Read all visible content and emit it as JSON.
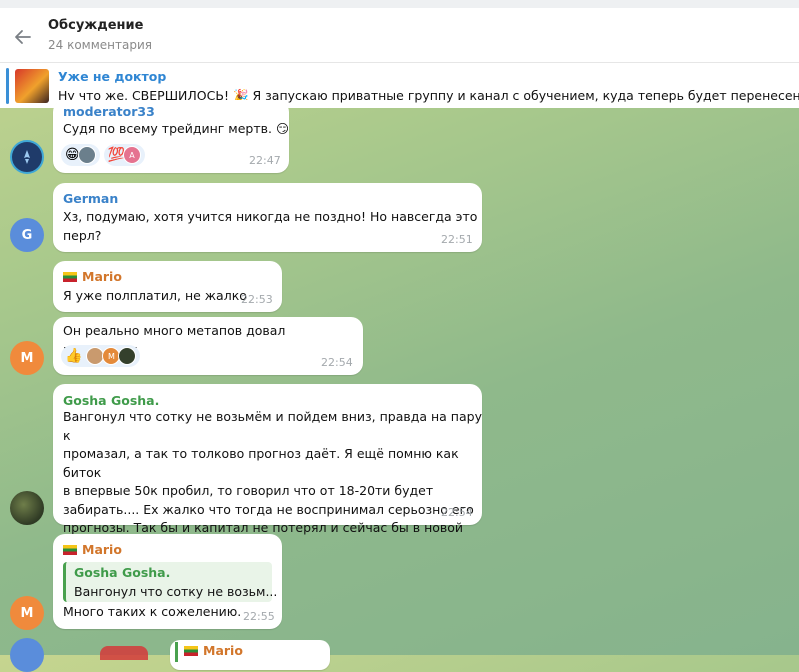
{
  "header": {
    "title": "Обсуждение",
    "subtitle": "24 комментария"
  },
  "pinned": {
    "name": "Уже не доктор",
    "text": "Ну что же, СВЕРШИЛОСЬ! 🎉  Я запускаю приватные группу и канал с обучением, куда теперь будет перенесено в"
  },
  "messages": [
    {
      "sender": "moderator33",
      "text": "Судя по всему трейдинг мертв. 😏",
      "time": "22:47",
      "reactions": [
        "😁",
        "💯"
      ]
    },
    {
      "sender": "German",
      "avatar_letter": "G",
      "text_lines": [
        "Хз, подумаю, хотя учится никогда не поздно! Но навсегда это",
        "перл?"
      ],
      "time": "22:51"
    },
    {
      "sender": "Mario",
      "text": "Я уже полплатил, не жалко",
      "time": "22:53"
    },
    {
      "text": "Он реально много метапов довал подьемных",
      "time": "22:54",
      "avatar_letter": "M",
      "reactions": [
        "👍"
      ]
    },
    {
      "sender": "Gosha Gosha.",
      "text_lines": [
        "Вангонул что сотку не возьмём и пойдем вниз, правда на пару к",
        "промазал, а так то толково прогноз даёт. Я ещё помню как биток",
        "в впервые 50к пробил, то говорил что от 18-20ти будет",
        "забирать.... Ех жалко что тогда не воспринимал серьозно его",
        "прогнозы. Так бы и капитал не потерял и сейчас бы в новой хате",
        "мебель ставил )"
      ],
      "time": "22:54"
    },
    {
      "sender": "Mario",
      "quote_name": "Gosha Gosha.",
      "quote_text": "Вангонул что сотку не возьм...",
      "text": "Много таких к сожелению.",
      "time": "22:55",
      "avatar_letter": "M"
    },
    {
      "sender": "Mario"
    }
  ],
  "colors": {
    "accent": "#3a82c9",
    "orange_name": "#d2762b",
    "green_name": "#3f9b4a"
  }
}
